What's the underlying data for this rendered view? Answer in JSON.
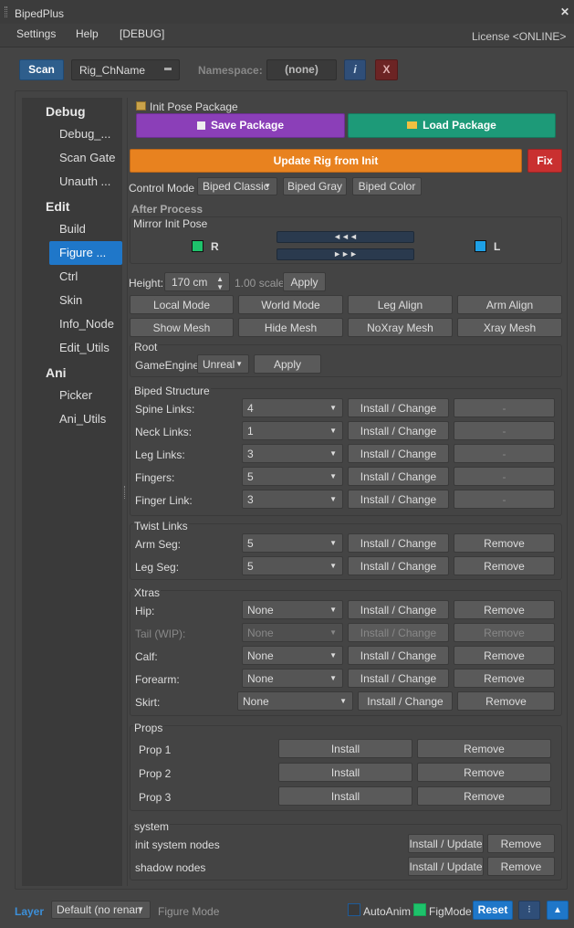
{
  "window": {
    "title": "BipedPlus",
    "close_glyph": "✕"
  },
  "menu": {
    "items": [
      "Settings",
      "Help",
      "[DEBUG]"
    ],
    "license": "License <ONLINE>"
  },
  "toolbar": {
    "scan": "Scan",
    "rig_name": "Rig_ChName",
    "namespace_label": "Namespace:",
    "namespace_value": "(none)",
    "info": "i",
    "clear": "X"
  },
  "nav": {
    "sections": [
      {
        "label": "Debug",
        "items": [
          "Debug_...",
          "Scan Gate",
          "Unauth ..."
        ]
      },
      {
        "label": "Edit",
        "items": [
          "Build",
          "Figure ...",
          "Ctrl",
          "Skin",
          "Info_Node",
          "Edit_Utils"
        ]
      },
      {
        "label": "Ani",
        "items": [
          "Picker",
          "Ani_Utils"
        ]
      }
    ],
    "selected": "Figure ..."
  },
  "init_pose": {
    "title": "Init Pose Package",
    "save": "Save Package",
    "load": "Load Package",
    "update": "Update Rig from Init",
    "fix": "Fix"
  },
  "control_mode": {
    "label": "Control Mode :",
    "value": "Biped Classic",
    "gray": "Biped Gray",
    "color": "Biped Color"
  },
  "after": {
    "title": "After Process",
    "mirror_title": "Mirror Init Pose",
    "r": "R",
    "l": "L",
    "left_arrows": "◄◄◄",
    "right_arrows": "►►►",
    "r_color": "#1ec26b",
    "l_color": "#1ea0e6"
  },
  "height": {
    "label": "Height:",
    "value": "170 cm",
    "scale": "1.00 scale",
    "apply": "Apply"
  },
  "modes": [
    "Local Mode",
    "World Mode",
    "Leg Align",
    "Arm Align",
    "Show Mesh",
    "Hide Mesh",
    "NoXray Mesh",
    "Xray Mesh"
  ],
  "root": {
    "title": "Root",
    "engine_label": "GameEngine:",
    "engine_value": "Unreal",
    "apply": "Apply"
  },
  "biped": {
    "title": "Biped Structure",
    "rows": [
      {
        "label": "Spine Links:",
        "value": "4",
        "action": "Install / Change",
        "extra": "-"
      },
      {
        "label": "Neck Links:",
        "value": "1",
        "action": "Install / Change",
        "extra": "-"
      },
      {
        "label": "Leg Links:",
        "value": "3",
        "action": "Install / Change",
        "extra": "-"
      },
      {
        "label": "Fingers:",
        "value": "5",
        "action": "Install / Change",
        "extra": "-"
      },
      {
        "label": "Finger Link:",
        "value": "3",
        "action": "Install / Change",
        "extra": "-"
      }
    ]
  },
  "twist": {
    "title": "Twist Links",
    "rows": [
      {
        "label": "Arm Seg:",
        "value": "5",
        "action": "Install / Change",
        "extra": "Remove"
      },
      {
        "label": "Leg Seg:",
        "value": "5",
        "action": "Install / Change",
        "extra": "Remove"
      }
    ]
  },
  "xtras": {
    "title": "Xtras",
    "rows": [
      {
        "label": "Hip:",
        "value": "None",
        "action": "Install / Change",
        "extra": "Remove"
      },
      {
        "label": "Tail (WIP):",
        "value": "None",
        "action": "Install / Change",
        "extra": "Remove"
      },
      {
        "label": "Calf:",
        "value": "None",
        "action": "Install / Change",
        "extra": "Remove"
      },
      {
        "label": "Forearm:",
        "value": "None",
        "action": "Install / Change",
        "extra": "Remove"
      },
      {
        "label": "Skirt:",
        "value": "None",
        "action": "Install / Change",
        "extra": "Remove"
      }
    ]
  },
  "props": {
    "title": "Props",
    "rows": [
      {
        "label": "Prop 1",
        "install": "Install",
        "remove": "Remove"
      },
      {
        "label": "Prop 2",
        "install": "Install",
        "remove": "Remove"
      },
      {
        "label": "Prop 3",
        "install": "Install",
        "remove": "Remove"
      }
    ]
  },
  "system": {
    "title": "system",
    "rows": [
      {
        "label": "init system nodes",
        "install": "Install / Update",
        "remove": "Remove"
      },
      {
        "label": "shadow nodes",
        "install": "Install / Update",
        "remove": "Remove"
      }
    ]
  },
  "footer": {
    "layer": "Layer",
    "layer_value": "Default (no renan",
    "mode": "Figure Mode",
    "autoanim": "AutoAnim",
    "figmode": "FigMode",
    "reset": "Reset",
    "more": "⁝",
    "up": "▲"
  }
}
